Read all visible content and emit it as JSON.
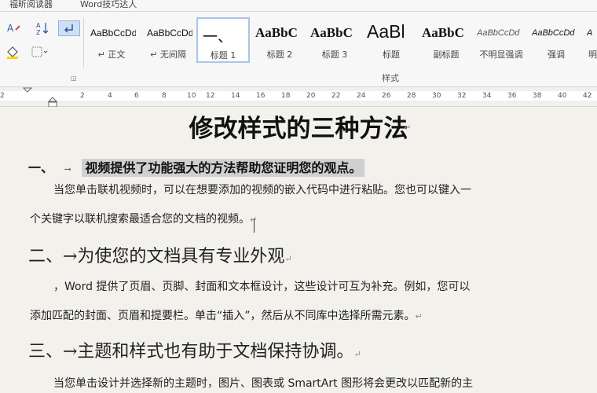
{
  "tabs": [
    "福昕阅读器",
    "Word技巧达人"
  ],
  "tools": [
    {
      "icon": "clear-format-icon",
      "glyph": "A͡"
    },
    {
      "icon": "sort-icon",
      "glyph": "↕"
    },
    {
      "icon": "show-marks-icon",
      "glyph": "↵"
    },
    {
      "icon": "fill-color-icon",
      "glyph": "◈"
    },
    {
      "icon": "borders-icon",
      "glyph": "▦"
    }
  ],
  "styles": [
    {
      "sample": "AaBbCcDd",
      "name": "↵ 正文"
    },
    {
      "sample": "AaBbCcDd",
      "name": "↵ 无间隔"
    },
    {
      "sample": "一、",
      "name": "标题 1"
    },
    {
      "sample": "AaBbC",
      "name": "标题 2"
    },
    {
      "sample": "AaBbC",
      "name": "标题 3"
    },
    {
      "sample": "AaBl",
      "name": "标题"
    },
    {
      "sample": "AaBbC",
      "name": "副标题"
    },
    {
      "sample": "AaBbCcDd",
      "name": "不明显强调"
    },
    {
      "sample": "AaBbCcDd",
      "name": "强调"
    },
    {
      "sample": "A",
      "name": "明"
    }
  ],
  "group_label": "样式",
  "ruler_ticks": [
    "2",
    "2",
    "4",
    "6",
    "8",
    "10",
    "12",
    "14",
    "16",
    "18",
    "20",
    "22",
    "24",
    "26",
    "28",
    "30",
    "32",
    "34",
    "36",
    "38",
    "40",
    "42"
  ],
  "doc": {
    "title": "修改样式的三种方法",
    "h1a_num": "一、",
    "h1a_text": "视频提供了功能强大的方法帮助您证明您的观点。",
    "p1a": "当您单击联机视频时，可以在想要添加的视频的嵌入代码中进行粘贴。您也可以键入一",
    "p1b": "个关键字以联机搜索最适合您的文档的视频。",
    "h1b": "二、→为使您的文档具有专业外观",
    "p2a": "，Word 提供了页眉、页脚、封面和文本框设计，这些设计可互为补充。例如，您可以",
    "p2b": "添加匹配的封面、页眉和提要栏。单击“插入”，然后从不同库中选择所需元素。",
    "h1c": "三、→主题和样式也有助于文档保持协调。",
    "p3a": "当您单击设计并选择新的主题时，图片、图表或 SmartArt 图形将会更改以匹配新的主",
    "para_mark": "↵",
    "tab_arrow": "→"
  }
}
